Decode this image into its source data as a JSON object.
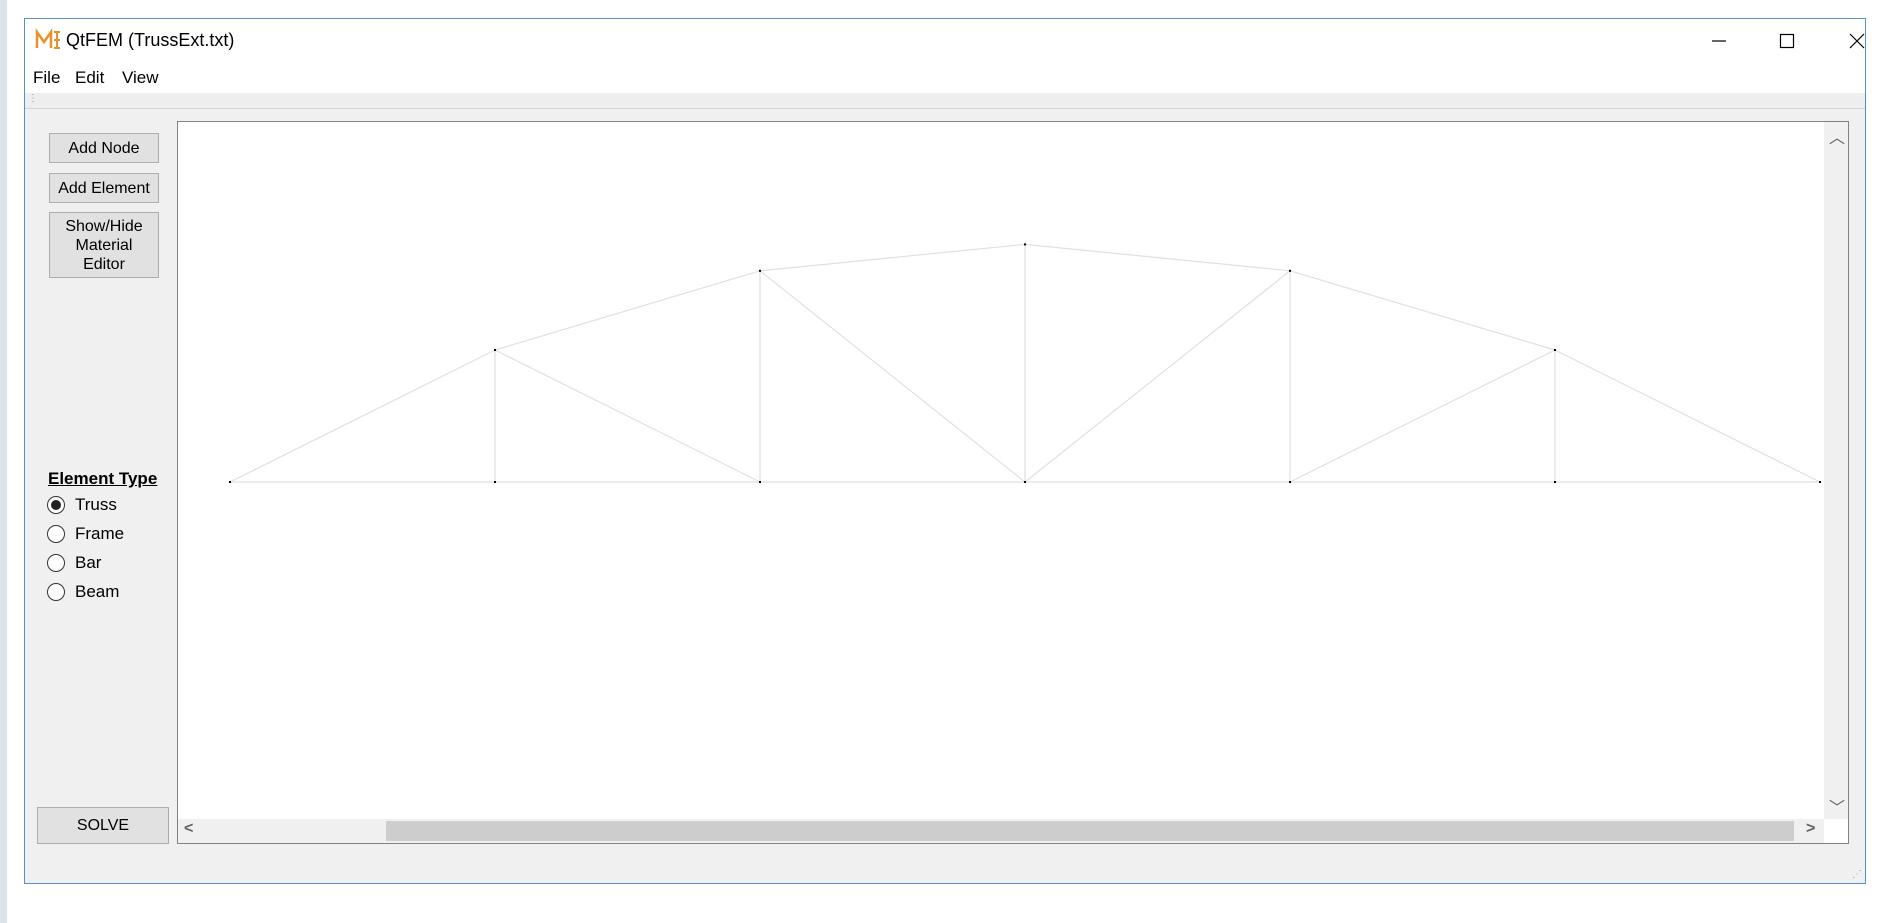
{
  "window": {
    "title": "QtFEM (TrussExt.txt)",
    "app_icon": "mesh-app-icon",
    "controls": {
      "minimize": "minimize-icon",
      "maximize": "maximize-icon",
      "close": "close-icon"
    }
  },
  "menu": [
    "File",
    "Edit",
    "View"
  ],
  "sidebar": {
    "add_node": "Add Node",
    "add_element": "Add Element",
    "material_editor": "Show/Hide Material Editor",
    "element_type_label": "Element Type",
    "element_types": [
      "Truss",
      "Frame",
      "Bar",
      "Beam"
    ],
    "selected_type": "Truss",
    "solve": "SOLVE"
  },
  "canvas": {
    "line_color": "#e0e0e0",
    "node_color": "#000000",
    "nodes": [
      [
        0,
        0
      ],
      [
        1,
        0
      ],
      [
        2,
        0
      ],
      [
        3,
        0
      ],
      [
        4,
        0
      ],
      [
        5,
        0
      ],
      [
        6,
        0
      ],
      [
        1,
        1
      ],
      [
        2,
        1.6
      ],
      [
        3,
        1.8
      ],
      [
        4,
        1.6
      ],
      [
        5,
        1
      ]
    ],
    "elements": [
      [
        0,
        1
      ],
      [
        1,
        2
      ],
      [
        2,
        3
      ],
      [
        3,
        4
      ],
      [
        4,
        5
      ],
      [
        5,
        6
      ],
      [
        0,
        7
      ],
      [
        7,
        8
      ],
      [
        8,
        9
      ],
      [
        9,
        10
      ],
      [
        10,
        11
      ],
      [
        11,
        6
      ],
      [
        1,
        7
      ],
      [
        2,
        8
      ],
      [
        3,
        9
      ],
      [
        4,
        10
      ],
      [
        5,
        11
      ],
      [
        7,
        2
      ],
      [
        8,
        3
      ],
      [
        3,
        10
      ],
      [
        4,
        11
      ]
    ]
  }
}
